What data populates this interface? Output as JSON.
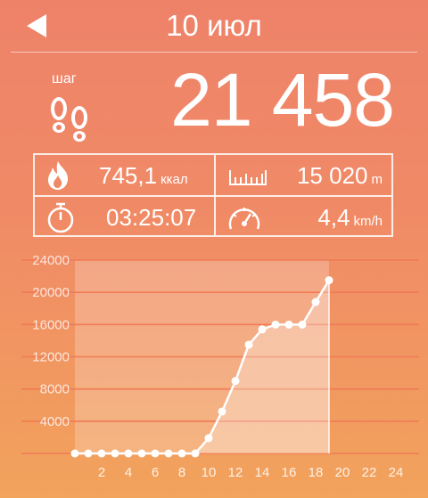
{
  "header": {
    "title": "10 июл",
    "back_icon": "back-arrow-icon"
  },
  "steps": {
    "label": "шаг",
    "value": "21 458",
    "icon": "footprints-icon"
  },
  "stats": {
    "calories": {
      "value": "745,1",
      "unit": "ккал",
      "icon": "flame-icon"
    },
    "distance": {
      "value": "15 020",
      "unit": "m",
      "icon": "ruler-icon"
    },
    "duration": {
      "value": "03:25:07",
      "icon": "stopwatch-icon"
    },
    "speed": {
      "value": "4,4",
      "unit": "km/h",
      "icon": "speedometer-icon"
    }
  },
  "colors": {
    "bg_top": "#ee8269",
    "bg_bottom": "#f2a35c",
    "foreground": "#ffffff",
    "grid": "#f07a55"
  },
  "chart_data": {
    "type": "area",
    "x": [
      0,
      1,
      2,
      3,
      4,
      5,
      6,
      7,
      8,
      9,
      10,
      11,
      12,
      13,
      14,
      15,
      16,
      17,
      18,
      19
    ],
    "values": [
      0,
      0,
      0,
      0,
      0,
      0,
      0,
      0,
      0,
      0,
      1900,
      5200,
      9000,
      13500,
      15400,
      16000,
      16000,
      16000,
      18800,
      21500
    ],
    "x_ticks": [
      "2",
      "4",
      "6",
      "8",
      "10",
      "12",
      "14",
      "16",
      "18",
      "20",
      "22",
      "24"
    ],
    "y_ticks": [
      "24000",
      "20000",
      "16000",
      "12000",
      "8000",
      "4000"
    ],
    "ylim": [
      0,
      24000
    ],
    "xlim": [
      0,
      24
    ],
    "grid": true,
    "highlight_range": [
      0,
      19
    ]
  }
}
